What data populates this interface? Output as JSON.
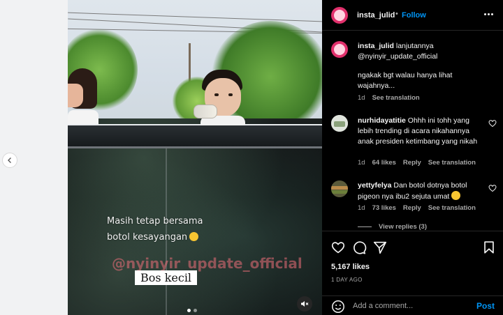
{
  "header": {
    "username": "insta_julid",
    "separator": "•",
    "follow_label": "Follow"
  },
  "media": {
    "caption_line1": "Masih tetap bersama",
    "caption_line2": "botol kesayangan",
    "watermark": "@nyinyir_update_official",
    "name_tag": "Bos kecil"
  },
  "caption_post": {
    "username": "insta_julid",
    "text_line1": " lanjutannya",
    "mention": "@nyinyir_update_official",
    "body": "ngakak bgt walau hanya lihat wajahnya...",
    "time": "1d",
    "see_translation": "See translation"
  },
  "comments": [
    {
      "username": "nurhidayatitie",
      "text": " Ohhh ini tohh yang lebih trending di acara nikahannya anak presiden ketimbang yang nikah",
      "time": "1d",
      "likes": "64 likes",
      "reply": "Reply",
      "see_translation": "See translation"
    },
    {
      "username": "yettyfelya",
      "text": " Dan botol dotnya botol pigeon nya ibu2 sejuta umat",
      "time": "1d",
      "likes": "73 likes",
      "reply": "Reply",
      "see_translation": "See translation",
      "view_replies": "View replies (3)"
    }
  ],
  "footer": {
    "likes": "5,167 likes",
    "date": "1 DAY AGO",
    "add_comment_placeholder": "Add a comment...",
    "post_label": "Post"
  },
  "colors": {
    "accent": "#0095f6",
    "panel_bg": "#000000",
    "muted_text": "#a8a8a8"
  }
}
